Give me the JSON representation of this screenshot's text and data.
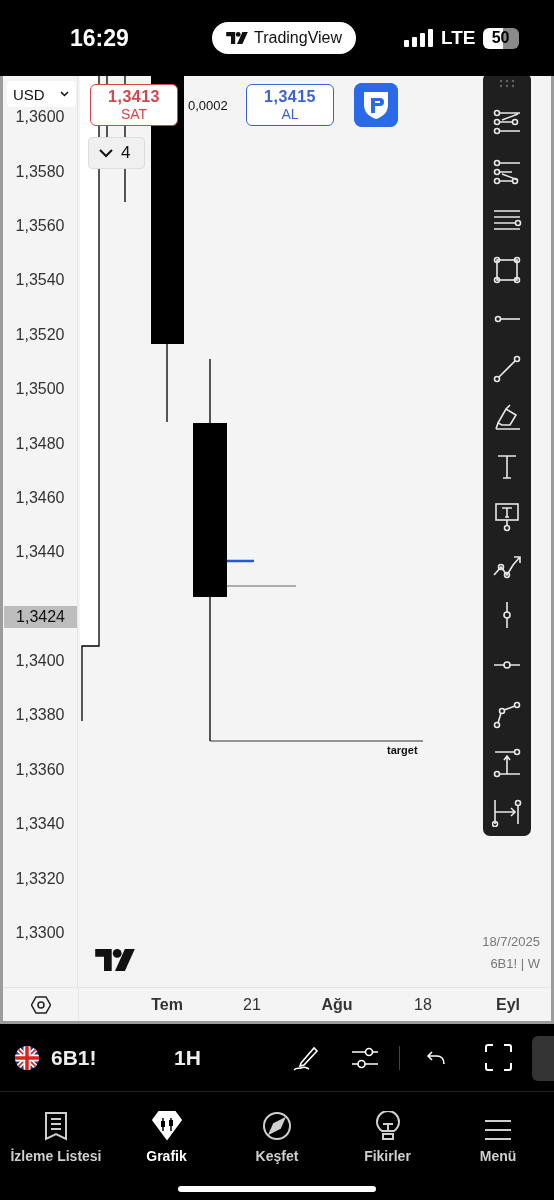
{
  "status_bar": {
    "time": "16:29",
    "app_pill": "TradingView",
    "network": "LTE",
    "battery": "50"
  },
  "chart": {
    "currency": "USD",
    "sell": {
      "price": "1,3413",
      "label": "SAT"
    },
    "spread": "0,0002",
    "buy": {
      "price": "1,3415",
      "label": "AL"
    },
    "quantity": "4",
    "price_axis_upper": [
      "1,3600",
      "1,3580",
      "1,3560",
      "1,3540",
      "1,3520",
      "1,3500",
      "1,3480",
      "1,3460",
      "1,3440"
    ],
    "current_price": "1,3424",
    "price_axis_lower": [
      "1,3400",
      "1,3380",
      "1,3360",
      "1,3340",
      "1,3320",
      "1,3300"
    ],
    "annotation": "target",
    "date": "18/7/2025",
    "series_label": "6B1! | W",
    "time_axis": [
      {
        "label": "Tem",
        "kind": "month"
      },
      {
        "label": "21",
        "kind": "day"
      },
      {
        "label": "Ağu",
        "kind": "month"
      },
      {
        "label": "18",
        "kind": "day"
      },
      {
        "label": "Eyl",
        "kind": "month"
      }
    ]
  },
  "symbol_bar": {
    "symbol": "6B1!",
    "interval": "1H"
  },
  "tab_bar": [
    {
      "label": "İzleme Listesi",
      "selected": false
    },
    {
      "label": "Grafik",
      "selected": true
    },
    {
      "label": "Keşfet",
      "selected": false
    },
    {
      "label": "Fikirler",
      "selected": false
    },
    {
      "label": "Menü",
      "selected": false
    }
  ]
}
